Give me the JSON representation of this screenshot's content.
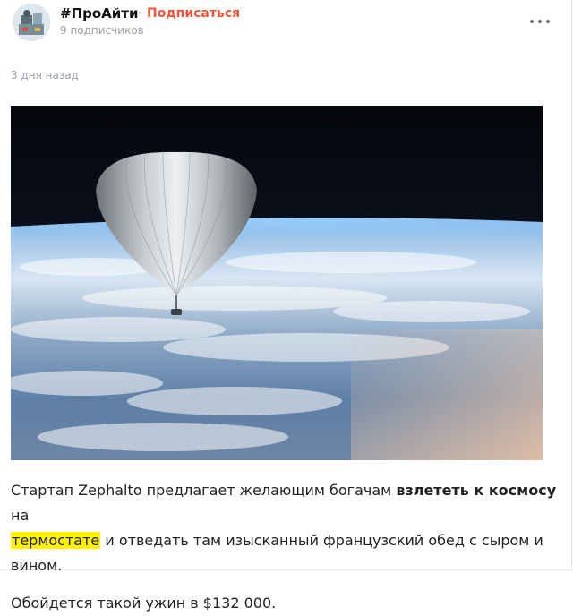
{
  "header": {
    "channel_name": "#ПроАйти",
    "separator": "·",
    "subscribe_label": "Подписаться",
    "subscribers": "9 подписчиков"
  },
  "post": {
    "time_ago": "3 дня назад",
    "text": {
      "p1_start": "Стартап Zephalto предлагает желающим богачам ",
      "p1_bold": "взлететь к космосу",
      "p1_after": " на",
      "p1_highlight": "термостате",
      "p1_end": " и отведать там изысканный французский обед с сыром и вином.",
      "p2": "Обойдется такой ужин в $132 000."
    }
  },
  "colors": {
    "accent": "#f0553c",
    "highlight": "#fff200",
    "muted": "#9aa0a6"
  },
  "icons": {
    "more": "more-dots-icon",
    "avatar": "channel-avatar"
  }
}
